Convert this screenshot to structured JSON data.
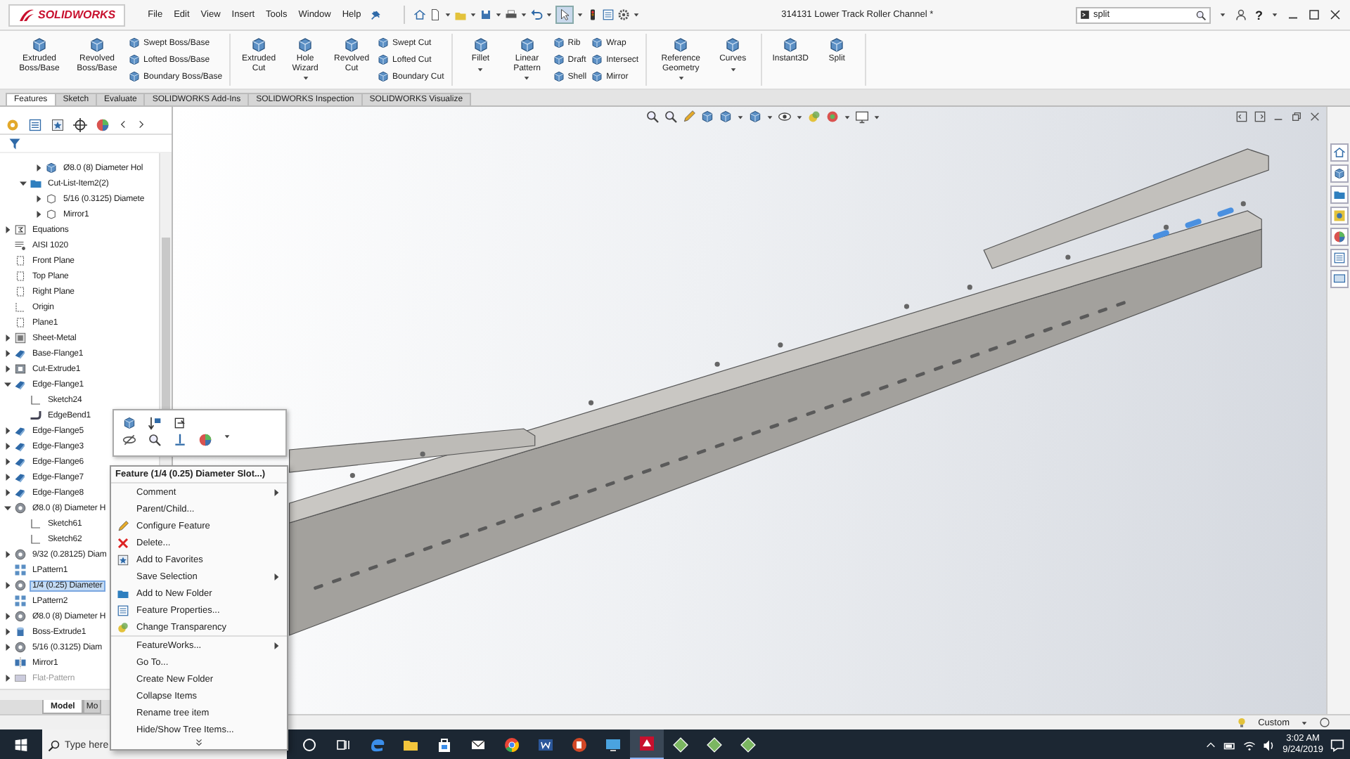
{
  "app": {
    "logo": "SOLIDWORKS",
    "title": "314131 Lower Track Roller Channel *",
    "help": "?"
  },
  "menus": [
    "File",
    "Edit",
    "View",
    "Insert",
    "Tools",
    "Window",
    "Help"
  ],
  "search": {
    "value": "split"
  },
  "ribbon": [
    {
      "large": [
        {
          "label": "Extruded Boss/Base",
          "dropdown": false
        },
        {
          "label": "Revolved Boss/Base",
          "dropdown": false
        }
      ],
      "columns": [
        [
          "Swept Boss/Base",
          "Lofted Boss/Base",
          "Boundary Boss/Base"
        ]
      ]
    },
    {
      "large": [
        {
          "label": "Extruded Cut",
          "dropdown": false
        },
        {
          "label": "Hole Wizard",
          "dropdown": true
        },
        {
          "label": "Revolved Cut",
          "dropdown": false
        }
      ],
      "columns": [
        [
          "Swept Cut",
          "Lofted Cut",
          "Boundary Cut"
        ]
      ]
    },
    {
      "large": [
        {
          "label": "Fillet",
          "dropdown": true
        },
        {
          "label": "Linear Pattern",
          "dropdown": true
        }
      ],
      "columns": [
        [
          "Rib",
          "Draft",
          "Shell"
        ],
        [
          "Wrap",
          "Intersect",
          "Mirror"
        ]
      ]
    },
    {
      "large": [
        {
          "label": "Reference Geometry",
          "dropdown": true
        },
        {
          "label": "Curves",
          "dropdown": true
        }
      ]
    },
    {
      "large": [
        {
          "label": "Instant3D",
          "dropdown": false
        },
        {
          "label": "Split",
          "dropdown": false
        }
      ]
    }
  ],
  "tabs": [
    {
      "label": "Features",
      "selected": true
    },
    {
      "label": "Sketch",
      "selected": false
    },
    {
      "label": "Evaluate",
      "selected": false
    },
    {
      "label": "SOLIDWORKS Add-Ins",
      "selected": false
    },
    {
      "label": "SOLIDWORKS Inspection",
      "selected": false
    },
    {
      "label": "SOLIDWORKS Visualize",
      "selected": false
    }
  ],
  "tree": [
    {
      "children": [
        {
          "children": [
            {
              "label": "Ø8.0 (8) Diameter Hol",
              "kind": "body",
              "expanded": false,
              "selected": false
            }
          ]
        },
        {
          "label": "Cut-List-Item2(2)",
          "kind": "folder",
          "expanded": true,
          "selected": false,
          "children": [
            {
              "label": "5/16 (0.3125) Diamete",
              "kind": "outline",
              "expanded": false,
              "selected": false
            },
            {
              "label": "Mirror1",
              "kind": "outline",
              "expanded": false,
              "selected": false
            }
          ]
        }
      ]
    },
    {
      "label": "Equations",
      "kind": "equations",
      "expanded": false,
      "selected": false
    },
    {
      "label": "AISI 1020",
      "kind": "material",
      "selected": false
    },
    {
      "label": "Front Plane",
      "kind": "plane",
      "selected": false
    },
    {
      "label": "Top Plane",
      "kind": "plane",
      "selected": false
    },
    {
      "label": "Right Plane",
      "kind": "plane",
      "selected": false
    },
    {
      "label": "Origin",
      "kind": "origin",
      "selected": false
    },
    {
      "label": "Plane1",
      "kind": "plane",
      "selected": false
    },
    {
      "label": "Sheet-Metal",
      "kind": "sheetmetal",
      "expanded": false,
      "selected": false
    },
    {
      "label": "Base-Flange1",
      "kind": "flange",
      "expanded": false,
      "selected": false
    },
    {
      "label": "Cut-Extrude1",
      "kind": "cut",
      "expanded": false,
      "selected": false
    },
    {
      "label": "Edge-Flange1",
      "kind": "flange",
      "expanded": true,
      "selected": false,
      "children": [
        {
          "label": "Sketch24",
          "kind": "sketch",
          "selected": false
        },
        {
          "label": "EdgeBend1",
          "kind": "bend",
          "selected": false
        }
      ]
    },
    {
      "label": "Edge-Flange5",
      "kind": "flange",
      "expanded": false,
      "selected": false
    },
    {
      "label": "Edge-Flange3",
      "kind": "flange",
      "expanded": false,
      "selected": false
    },
    {
      "label": "Edge-Flange6",
      "kind": "flange",
      "expanded": false,
      "selected": false
    },
    {
      "label": "Edge-Flange7",
      "kind": "flange",
      "expanded": false,
      "selected": false
    },
    {
      "label": "Edge-Flange8",
      "kind": "flange",
      "expanded": false,
      "selected": false
    },
    {
      "label": "Ø8.0 (8) Diameter H",
      "kind": "hole",
      "expanded": true,
      "selected": false,
      "children": [
        {
          "label": "Sketch61",
          "kind": "sketch",
          "selected": false
        },
        {
          "label": "Sketch62",
          "kind": "sketch",
          "selected": false
        }
      ]
    },
    {
      "label": "9/32 (0.28125) Diam",
      "kind": "hole",
      "expanded": false,
      "selected": false
    },
    {
      "label": "LPattern1",
      "kind": "pattern",
      "selected": false
    },
    {
      "label": "1/4 (0.25) Diameter",
      "kind": "hole",
      "expanded": false,
      "selected": true
    },
    {
      "label": "LPattern2",
      "kind": "pattern",
      "selected": false
    },
    {
      "label": "Ø8.0 (8) Diameter H",
      "kind": "hole",
      "expanded": false,
      "selected": false
    },
    {
      "label": "Boss-Extrude1",
      "kind": "boss",
      "expanded": false,
      "selected": false
    },
    {
      "label": "5/16 (0.3125) Diam",
      "kind": "hole",
      "expanded": false,
      "selected": false
    },
    {
      "label": "Mirror1",
      "kind": "mirror",
      "selected": false
    },
    {
      "label": "Flat-Pattern",
      "kind": "flat",
      "expanded": false,
      "selected": false,
      "disabled": true
    }
  ],
  "tree_tabs": [
    {
      "label": "Model",
      "selected": true
    },
    {
      "label": "Mo",
      "selected": false
    }
  ],
  "context_menu": {
    "title": "Feature (1/4 (0.25) Diameter Slot...)",
    "groups": [
      [
        {
          "label": "Comment",
          "kind": "plain",
          "submenu": true
        },
        {
          "label": "Parent/Child...",
          "kind": "plain",
          "submenu": false
        },
        {
          "label": "Configure Feature",
          "kind": "configure",
          "submenu": false
        },
        {
          "label": "Delete...",
          "kind": "delete",
          "submenu": false
        },
        {
          "label": "Add to Favorites",
          "kind": "favorite",
          "submenu": false
        },
        {
          "label": "Save Selection",
          "kind": "plain",
          "submenu": true
        },
        {
          "label": "Add to New Folder",
          "kind": "folder",
          "submenu": false
        },
        {
          "label": "Feature Properties...",
          "kind": "properties",
          "submenu": false
        },
        {
          "label": "Change Transparency",
          "kind": "transparency",
          "submenu": false
        }
      ],
      [
        {
          "label": "FeatureWorks...",
          "kind": "plain",
          "submenu": true
        },
        {
          "label": "Go To...",
          "kind": "plain",
          "submenu": false
        },
        {
          "label": "Create New Folder",
          "kind": "plain",
          "submenu": false
        },
        {
          "label": "Collapse Items",
          "kind": "plain",
          "submenu": false
        },
        {
          "label": "Rename tree item",
          "kind": "plain",
          "submenu": false
        },
        {
          "label": "Hide/Show Tree Items...",
          "kind": "plain",
          "submenu": false
        }
      ]
    ]
  },
  "status_bar": {
    "configuration": "Custom"
  },
  "taskbar": {
    "search": {
      "placeholder": "Type here"
    },
    "apps": [
      {
        "kind": "cortana",
        "active": false
      },
      {
        "kind": "taskview",
        "active": false
      },
      {
        "kind": "edge",
        "active": false
      },
      {
        "kind": "explorer",
        "active": false
      },
      {
        "kind": "store",
        "active": false
      },
      {
        "kind": "mail",
        "active": false
      },
      {
        "kind": "chrome",
        "active": false
      },
      {
        "kind": "word",
        "active": false
      },
      {
        "kind": "powerpoint",
        "active": false
      },
      {
        "kind": "remote",
        "active": false
      },
      {
        "kind": "solidworks",
        "active": true
      },
      {
        "kind": "app",
        "active": false
      },
      {
        "kind": "app",
        "active": false
      },
      {
        "kind": "app",
        "active": false
      }
    ],
    "time": "3:02 AM",
    "date": "9/24/2019"
  }
}
